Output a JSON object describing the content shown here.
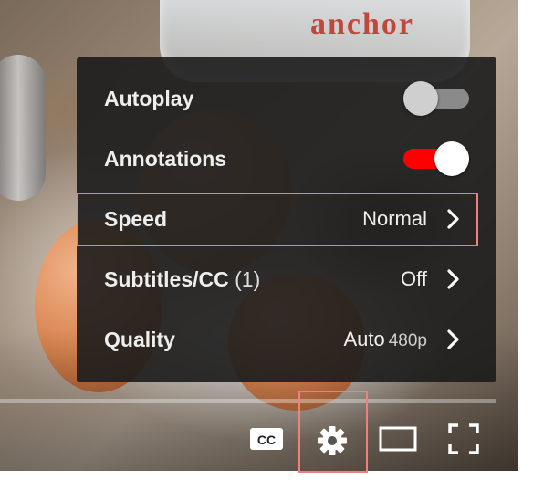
{
  "video": {
    "jar_text": "anchor"
  },
  "settings_menu": {
    "items": [
      {
        "label": "Autoplay",
        "type": "toggle",
        "on": false
      },
      {
        "label": "Annotations",
        "type": "toggle",
        "on": true
      },
      {
        "label": "Speed",
        "value": "Normal"
      },
      {
        "label": "Subtitles/CC",
        "count": "(1)",
        "value": "Off"
      },
      {
        "label": "Quality",
        "value": "Auto",
        "resolution": "480p"
      }
    ]
  },
  "controls": {
    "cc_label": "CC"
  },
  "colors": {
    "menu_background": "#1c1c1c",
    "toggle_on_track": "#ff0000",
    "toggle_off_track": "#8a8a8a",
    "highlight_border": "#f08080"
  },
  "icons": [
    "chevron-right-icon",
    "gear-icon",
    "theater-mode-icon",
    "fullscreen-icon",
    "closed-captions-icon"
  ]
}
